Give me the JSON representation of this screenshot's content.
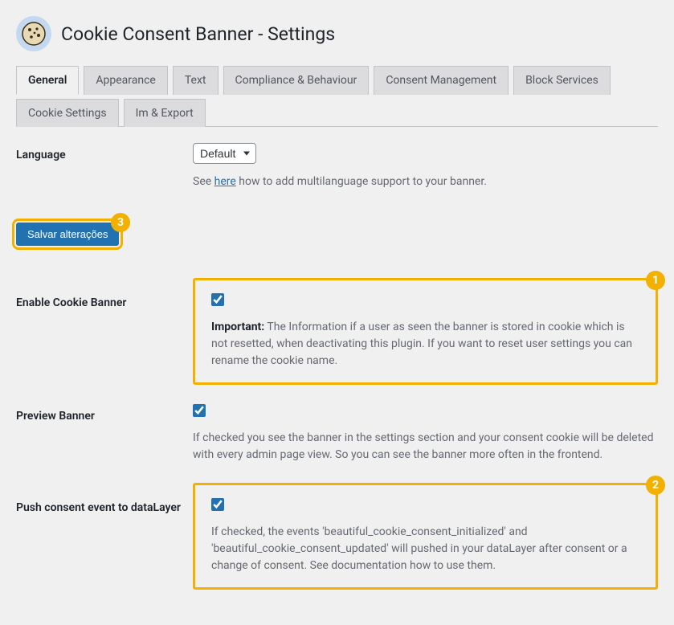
{
  "header": {
    "title": "Cookie Consent Banner - Settings"
  },
  "tabs": [
    {
      "label": "General",
      "active": true
    },
    {
      "label": "Appearance",
      "active": false
    },
    {
      "label": "Text",
      "active": false
    },
    {
      "label": "Compliance & Behaviour",
      "active": false
    },
    {
      "label": "Consent Management",
      "active": false
    },
    {
      "label": "Block Services",
      "active": false
    },
    {
      "label": "Cookie Settings",
      "active": false
    },
    {
      "label": "Im & Export",
      "active": false
    }
  ],
  "language": {
    "label": "Language",
    "value": "Default",
    "desc_prefix": "See ",
    "desc_link": "here",
    "desc_suffix": " how to add multilanguage support to your banner."
  },
  "save": {
    "label": "Salvar alterações",
    "badge": "3"
  },
  "enable_banner": {
    "label": "Enable Cookie Banner",
    "checked": true,
    "desc_strong": "Important:",
    "desc": " The Information if a user as seen the banner is stored in cookie which is not resetted, when deactivating this plugin. If you want to reset user settings you can rename the cookie name.",
    "badge": "1"
  },
  "preview_banner": {
    "label": "Preview Banner",
    "checked": true,
    "desc": "If checked you see the banner in the settings section and your consent cookie will be deleted with every admin page view. So you can see the banner more often in the frontend."
  },
  "push_consent": {
    "label": "Push consent event to dataLayer",
    "checked": true,
    "desc": "If checked, the events 'beautiful_cookie_consent_initialized' and 'beautiful_cookie_consent_updated' will pushed in your dataLayer after consent or a change of consent. See documentation how to use them.",
    "badge": "2"
  }
}
